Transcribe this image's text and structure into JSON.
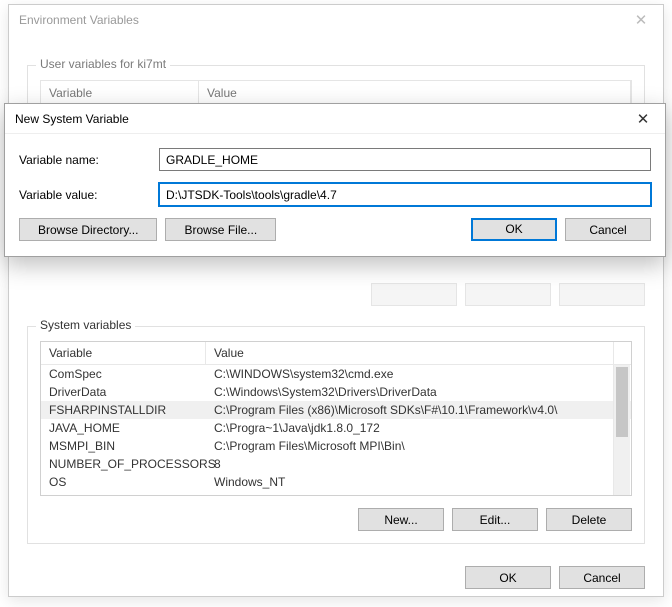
{
  "main_window": {
    "title": "Environment Variables",
    "user_vars_label": "User variables for ki7mt",
    "col_variable": "Variable",
    "col_value": "Value",
    "system_vars_label": "System variables",
    "new_label": "New...",
    "edit_label": "Edit...",
    "delete_label": "Delete",
    "ok_label": "OK",
    "cancel_label": "Cancel"
  },
  "system_vars": [
    {
      "name": "ComSpec",
      "value": "C:\\WINDOWS\\system32\\cmd.exe"
    },
    {
      "name": "DriverData",
      "value": "C:\\Windows\\System32\\Drivers\\DriverData"
    },
    {
      "name": "FSHARPINSTALLDIR",
      "value": "C:\\Program Files (x86)\\Microsoft SDKs\\F#\\10.1\\Framework\\v4.0\\"
    },
    {
      "name": "JAVA_HOME",
      "value": "C:\\Progra~1\\Java\\jdk1.8.0_172"
    },
    {
      "name": "MSMPI_BIN",
      "value": "C:\\Program Files\\Microsoft MPI\\Bin\\"
    },
    {
      "name": "NUMBER_OF_PROCESSORS",
      "value": "8"
    },
    {
      "name": "OS",
      "value": "Windows_NT"
    }
  ],
  "highlight_index": 2,
  "modal": {
    "title": "New System Variable",
    "name_label": "Variable name:",
    "name_value": "GRADLE_HOME",
    "value_label": "Variable value:",
    "value_value": "D:\\JTSDK-Tools\\tools\\gradle\\4.7",
    "browse_dir_label": "Browse Directory...",
    "browse_file_label": "Browse File...",
    "ok_label": "OK",
    "cancel_label": "Cancel"
  }
}
